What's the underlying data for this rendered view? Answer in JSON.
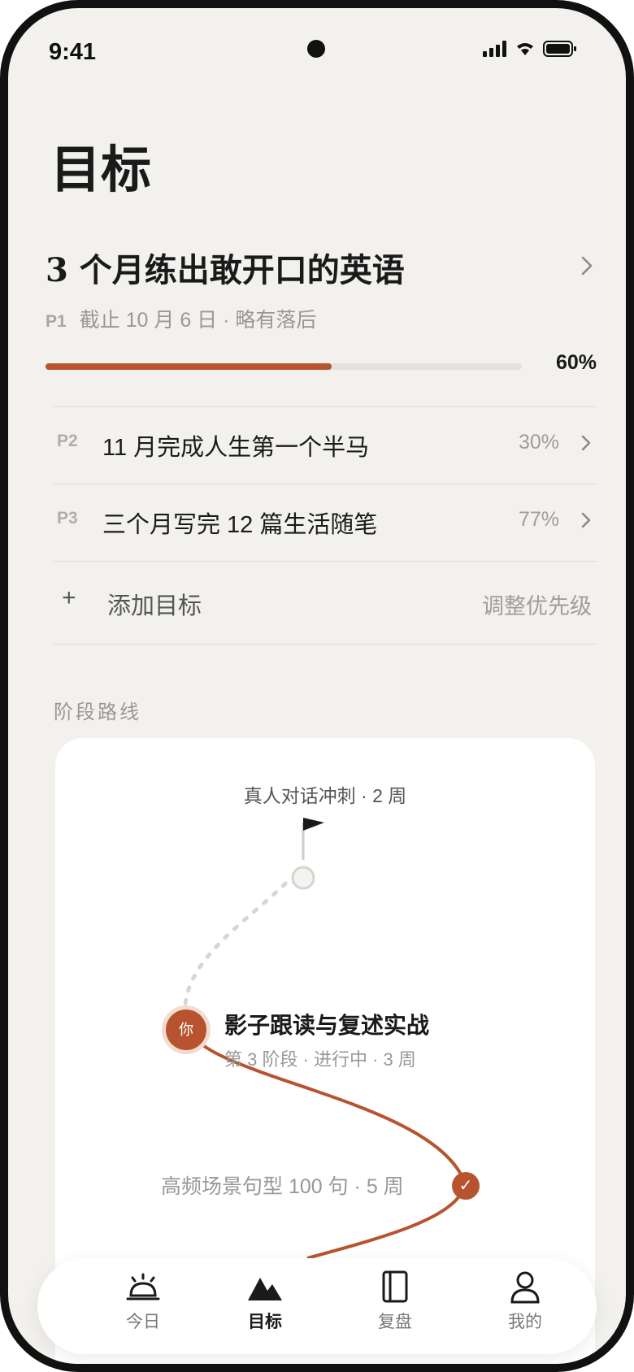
{
  "status_bar": {
    "time": "9:41"
  },
  "page": {
    "title": "目标"
  },
  "primary_goal": {
    "title": "3 个月练出敢开口的英语",
    "priority": "P1",
    "meta": "截止 10 月 6 日 · 略有落后",
    "progress": 0.6,
    "progress_label": "60%"
  },
  "goals": [
    {
      "priority": "P2",
      "name": "11 月完成人生第一个半马",
      "percent": "30%"
    },
    {
      "priority": "P3",
      "name": "三个月写完 12 篇生活随笔",
      "percent": "77%"
    }
  ],
  "actions": {
    "add_goal": "添加目标",
    "add_icon": "+",
    "reorder": "调整优先级"
  },
  "roadmap": {
    "section_label": "阶段路线",
    "future_stage": "真人对话冲刺 · 2 周",
    "current_stage": {
      "title": "影子跟读与复述实战",
      "meta": "第 3 阶段 · 进行中 · 3 周",
      "badge": "你"
    },
    "done_stage": {
      "label": "高频场景句型 100 句 · 5 周",
      "badge": "✓"
    }
  },
  "tabs": [
    {
      "label": "今日",
      "icon": "bell-icon"
    },
    {
      "label": "目标",
      "icon": "mountain-icon",
      "active": true
    },
    {
      "label": "复盘",
      "icon": "book-icon"
    },
    {
      "label": "我的",
      "icon": "person-icon"
    }
  ],
  "colors": {
    "accent": "#b8532f",
    "background": "#f2f1ee",
    "card": "#ffffff"
  }
}
